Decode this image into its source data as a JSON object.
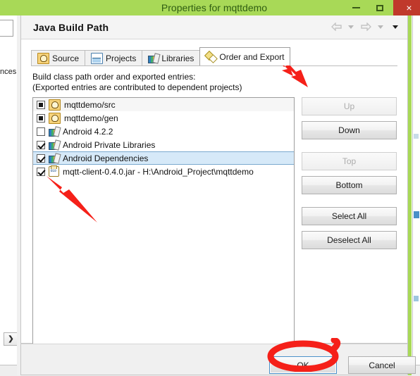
{
  "background": {
    "left_label": "nces",
    "scroll_button": "❯"
  },
  "dialog": {
    "title": "Properties for mqttdemo",
    "window_buttons": {
      "minimize": "minimize-icon",
      "maximize": "maximize-icon",
      "close": "×"
    },
    "page_title": "Java Build Path",
    "header_nav": [
      {
        "name": "back-arrow-icon",
        "glyph": "⇦"
      },
      {
        "name": "back-dropdown-icon",
        "glyph": "▼"
      },
      {
        "name": "forward-arrow-icon",
        "glyph": "⇨"
      },
      {
        "name": "forward-dropdown-icon",
        "glyph": "▼"
      },
      {
        "name": "menu-dropdown-icon",
        "glyph": "▼"
      }
    ],
    "tabs": [
      {
        "label": "Source",
        "icon": "source-folder-icon",
        "active": false
      },
      {
        "label": "Projects",
        "icon": "projects-icon",
        "active": false
      },
      {
        "label": "Libraries",
        "icon": "libraries-books-icon",
        "active": false
      },
      {
        "label": "Order and Export",
        "icon": "order-export-icon",
        "active": true
      }
    ],
    "description_line1": "Build class path order and exported entries:",
    "description_line2": "(Exported entries are contributed to dependent projects)",
    "entries": [
      {
        "label": "mqttdemo/src",
        "checkbox": "partial",
        "icon": "package-folder-icon",
        "selected": false
      },
      {
        "label": "mqttdemo/gen",
        "checkbox": "partial",
        "icon": "package-folder-icon",
        "selected": false
      },
      {
        "label": "Android 4.2.2",
        "checkbox": "unchecked",
        "icon": "library-books-icon",
        "selected": false
      },
      {
        "label": "Android Private Libraries",
        "checkbox": "checked",
        "icon": "library-books-icon",
        "selected": false
      },
      {
        "label": "Android Dependencies",
        "checkbox": "checked",
        "icon": "library-books-icon",
        "selected": true
      },
      {
        "label": "mqtt-client-0.4.0.jar - H:\\Android_Project\\mqttdemo",
        "checkbox": "checked",
        "icon": "jar-file-icon",
        "selected": false
      }
    ],
    "side_buttons": [
      {
        "label": "Up",
        "enabled": false
      },
      {
        "label": "Down",
        "enabled": true
      },
      {
        "label": "Top",
        "enabled": false
      },
      {
        "label": "Bottom",
        "enabled": true
      },
      {
        "label": "Select All",
        "enabled": true
      },
      {
        "label": "Deselect All",
        "enabled": true
      }
    ],
    "footer": {
      "ok_label": "OK",
      "cancel_label": "Cancel"
    }
  },
  "annotations": {
    "accent_color": "#f52019",
    "arrow_to_tab": "red-arrow-pointing-to-order-and-export-tab",
    "arrow_to_checkbox": "red-arrow-pointing-to-jar-checkbox",
    "circle_on_ok": "red-circle-around-ok-button"
  },
  "colors": {
    "title_bar": "#a8d957",
    "title_text": "#2f5d12",
    "close_button": "#c0392b",
    "selection": "#d6e9f8",
    "selection_border": "#7aa9cf",
    "annotation_red": "#f52019"
  }
}
